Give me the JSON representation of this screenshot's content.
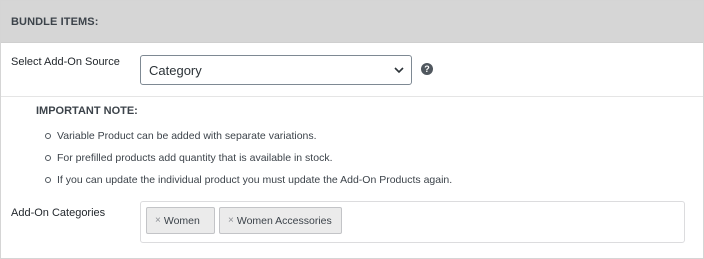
{
  "header": {
    "title": "BUNDLE ITEMS:"
  },
  "source": {
    "label": "Select Add-On Source",
    "selected": "Category",
    "help_icon": "help-icon"
  },
  "note": {
    "heading": "IMPORTANT NOTE:",
    "items": [
      "Variable Product can be added with separate variations.",
      "For prefilled products add quantity that is available in stock.",
      "If you can update the individual product you must update the Add-On Products again."
    ]
  },
  "categories": {
    "label": "Add-On Categories",
    "remove_symbol": "×",
    "tags": [
      "Women",
      "Women Accessories"
    ]
  }
}
